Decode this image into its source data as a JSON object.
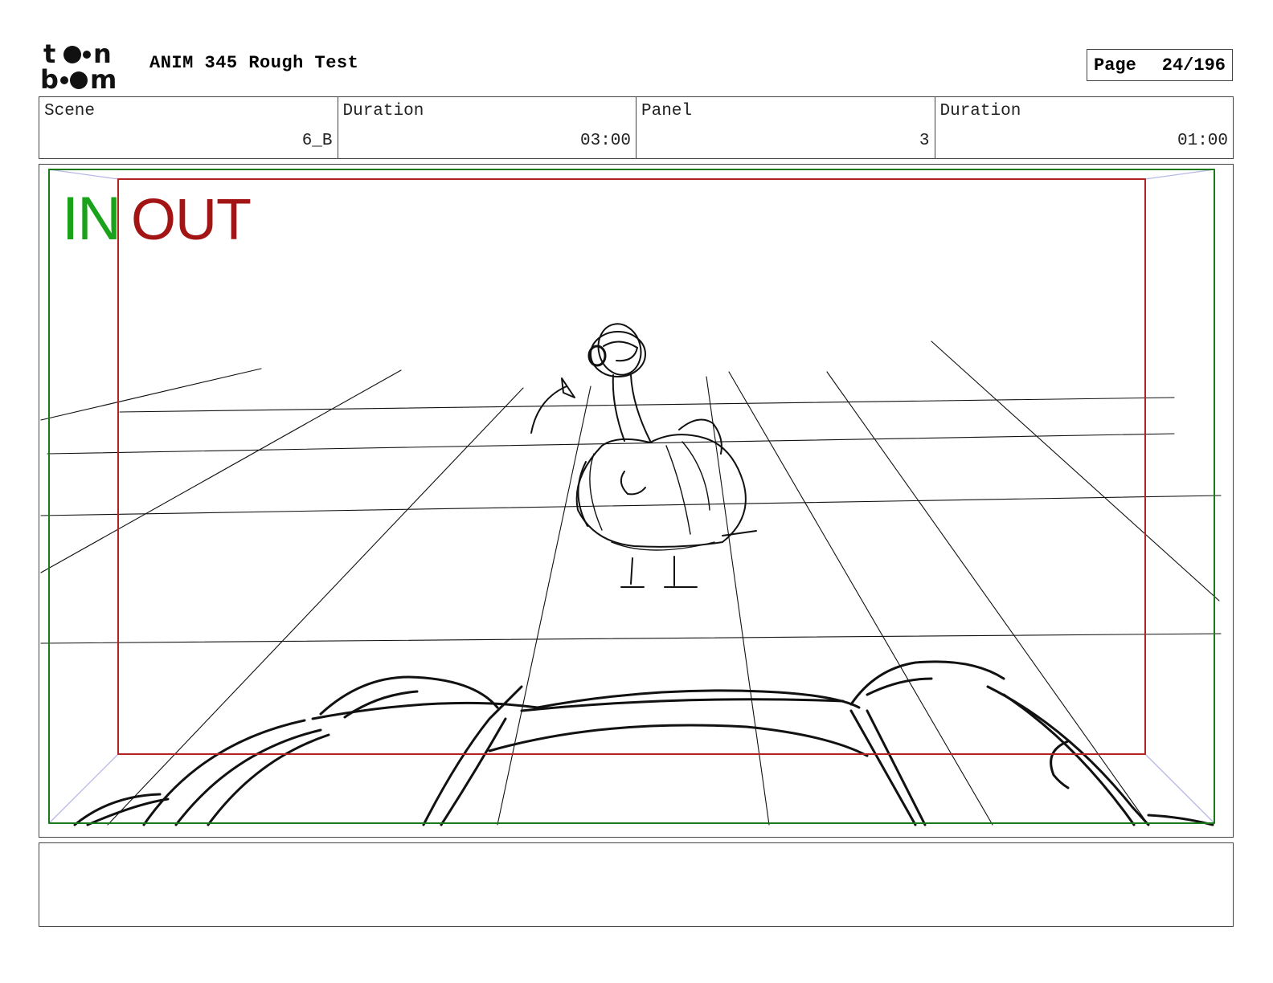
{
  "header": {
    "logo_text": "toon boom",
    "title": "ANIM 345 Rough Test",
    "page_label": "Page",
    "page_value": "24/196"
  },
  "info": {
    "scene_label": "Scene",
    "scene_value": "6_B",
    "scene_duration_label": "Duration",
    "scene_duration_value": "03:00",
    "panel_label": "Panel",
    "panel_value": "3",
    "panel_duration_label": "Duration",
    "panel_duration_value": "01:00"
  },
  "panel": {
    "in_label": "IN",
    "out_label": "OUT",
    "in_color": "#1aa31a",
    "out_color": "#a31414",
    "sketch_subject": "rough sketch of a bird standing on a tiled floor, seen past a foreground object"
  },
  "notes": {
    "text": ""
  }
}
